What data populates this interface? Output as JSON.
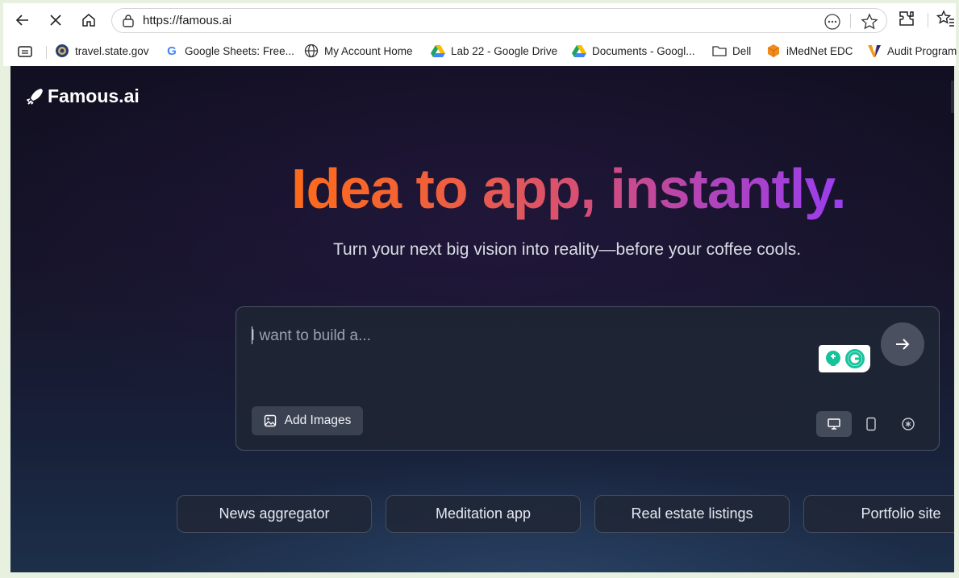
{
  "browser": {
    "url": "https://famous.ai",
    "bookmarks": [
      {
        "label": "travel.state.gov",
        "icon": "seal-icon"
      },
      {
        "label": "Google Sheets: Free...",
        "icon": "google-icon"
      },
      {
        "label": "My Account Home",
        "icon": "globe-icon"
      },
      {
        "label": "Lab 22 - Google Drive",
        "icon": "drive-icon"
      },
      {
        "label": "Documents - Googl...",
        "icon": "drive-icon"
      },
      {
        "label": "Dell",
        "icon": "folder-icon"
      },
      {
        "label": "iMedNet EDC",
        "icon": "cube-icon"
      },
      {
        "label": "Audit Program",
        "icon": "v-logo-icon"
      }
    ]
  },
  "page": {
    "brand": "Famous.ai",
    "headline": "Idea to app, instantly.",
    "subheadline": "Turn your next big vision into reality—before your coffee cools.",
    "prompt": {
      "placeholder": "I want to build a...",
      "add_images_label": "Add Images"
    },
    "suggestions": [
      "News aggregator",
      "Meditation app",
      "Real estate listings",
      "Portfolio site"
    ]
  },
  "colors": {
    "headline_start": "#ff6b1a",
    "headline_end": "#9a3df0",
    "page_bg": "#141226"
  }
}
